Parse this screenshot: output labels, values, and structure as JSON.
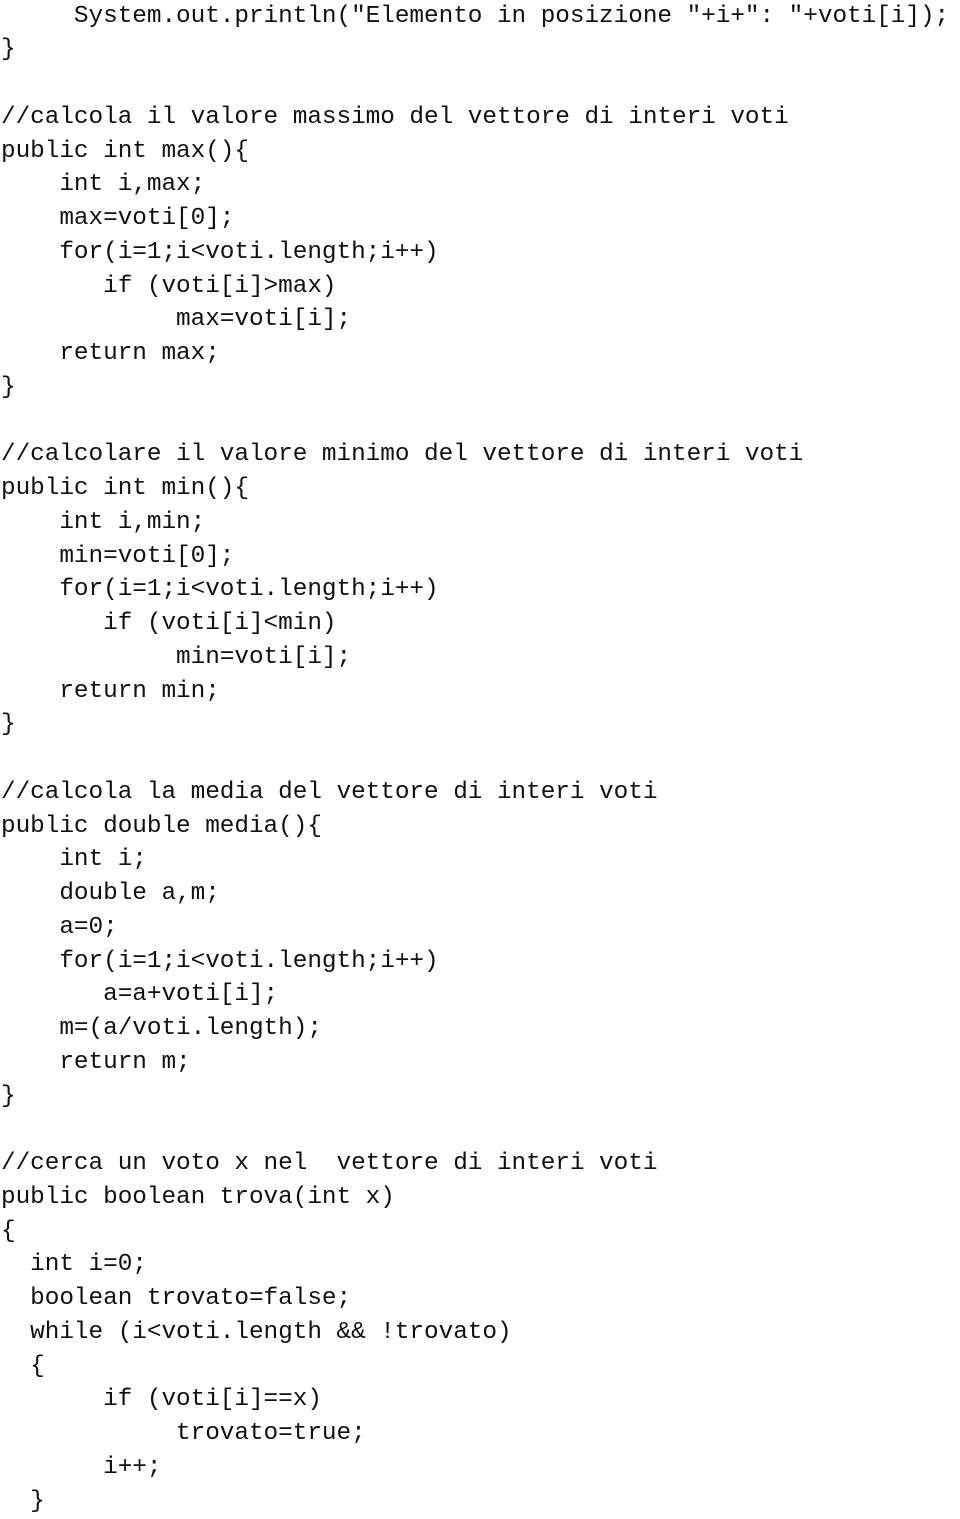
{
  "document": {
    "language": "Java",
    "lines": [
      "     System.out.println(\"Elemento in posizione \"+i+\": \"+voti[i]);",
      "}",
      "",
      "//calcola il valore massimo del vettore di interi voti",
      "public int max(){",
      "    int i,max;",
      "    max=voti[0];",
      "    for(i=1;i<voti.length;i++)",
      "       if (voti[i]>max)",
      "            max=voti[i];",
      "    return max;",
      "}",
      "",
      "//calcolare il valore minimo del vettore di interi voti",
      "public int min(){",
      "    int i,min;",
      "    min=voti[0];",
      "    for(i=1;i<voti.length;i++)",
      "       if (voti[i]<min)",
      "            min=voti[i];",
      "    return min;",
      "}",
      "",
      "//calcola la media del vettore di interi voti",
      "public double media(){",
      "    int i;",
      "    double a,m;",
      "    a=0;",
      "    for(i=1;i<voti.length;i++)",
      "       a=a+voti[i];",
      "    m=(a/voti.length);",
      "    return m;",
      "}",
      "",
      "//cerca un voto x nel  vettore di interi voti",
      "public boolean trova(int x)",
      "{",
      "  int i=0;",
      "  boolean trovato=false;",
      "  while (i<voti.length && !trovato)",
      "  {",
      "       if (voti[i]==x)",
      "            trovato=true;",
      "       i++;",
      "  }"
    ]
  }
}
